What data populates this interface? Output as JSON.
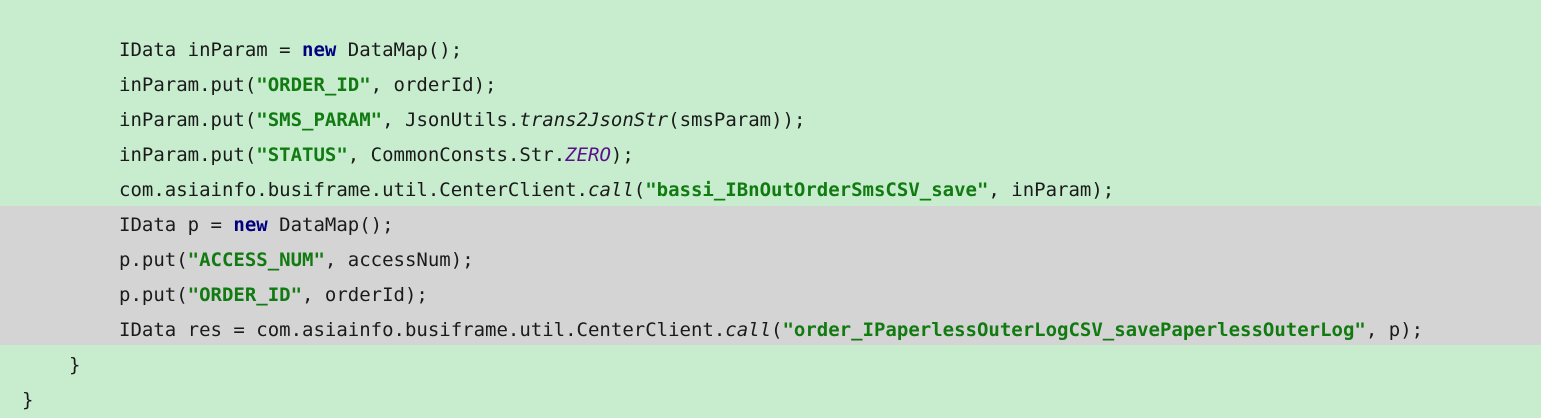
{
  "code": {
    "lines": [
      {
        "indent": 119,
        "tokens": [
          {
            "t": "plain",
            "v": "IData inParam = "
          },
          {
            "t": "kw",
            "v": "new"
          },
          {
            "t": "plain",
            "v": " DataMap();"
          }
        ]
      },
      {
        "indent": 119,
        "tokens": [
          {
            "t": "plain",
            "v": "inParam.put("
          },
          {
            "t": "str",
            "v": "\"ORDER_ID\""
          },
          {
            "t": "plain",
            "v": ", orderId);"
          }
        ]
      },
      {
        "indent": 119,
        "tokens": [
          {
            "t": "plain",
            "v": "inParam.put("
          },
          {
            "t": "str",
            "v": "\"SMS_PARAM\""
          },
          {
            "t": "plain",
            "v": ", JsonUtils."
          },
          {
            "t": "static",
            "v": "trans2JsonStr"
          },
          {
            "t": "plain",
            "v": "(smsParam));"
          }
        ]
      },
      {
        "indent": 119,
        "tokens": [
          {
            "t": "plain",
            "v": "inParam.put("
          },
          {
            "t": "str",
            "v": "\"STATUS\""
          },
          {
            "t": "plain",
            "v": ", CommonConsts.Str."
          },
          {
            "t": "field",
            "v": "ZERO"
          },
          {
            "t": "plain",
            "v": ");"
          }
        ]
      },
      {
        "indent": 119,
        "tokens": [
          {
            "t": "plain",
            "v": "com.asiainfo.busiframe.util.CenterClient."
          },
          {
            "t": "static",
            "v": "call"
          },
          {
            "t": "plain",
            "v": "("
          },
          {
            "t": "str",
            "v": "\"bassi_IBnOutOrderSmsCSV_save\""
          },
          {
            "t": "plain",
            "v": ", inParam);"
          }
        ]
      },
      {
        "indent": 119,
        "tokens": [
          {
            "t": "plain",
            "v": "IData p = "
          },
          {
            "t": "kw",
            "v": "new"
          },
          {
            "t": "plain",
            "v": " DataMap();"
          }
        ]
      },
      {
        "indent": 119,
        "tokens": [
          {
            "t": "plain",
            "v": "p.put("
          },
          {
            "t": "str",
            "v": "\"ACCESS_NUM\""
          },
          {
            "t": "plain",
            "v": ", accessNum);"
          }
        ]
      },
      {
        "indent": 119,
        "tokens": [
          {
            "t": "plain",
            "v": "p.put("
          },
          {
            "t": "str",
            "v": "\"ORDER_ID\""
          },
          {
            "t": "plain",
            "v": ", orderId);"
          }
        ]
      },
      {
        "indent": 119,
        "tokens": [
          {
            "t": "plain",
            "v": "IData res = com.asiainfo.busiframe.util.CenterClient."
          },
          {
            "t": "static",
            "v": "call"
          },
          {
            "t": "plain",
            "v": "("
          },
          {
            "t": "str",
            "v": "\"order_IPaperlessOuterLogCSV_savePaperlessOuterLog\""
          },
          {
            "t": "plain",
            "v": ", p);"
          }
        ]
      },
      {
        "indent": 69,
        "tokens": [
          {
            "t": "plain",
            "v": "}"
          }
        ]
      },
      {
        "indent": 22,
        "tokens": [
          {
            "t": "plain",
            "v": "}"
          }
        ]
      }
    ]
  },
  "colors": {
    "background": "#c7ecce",
    "selection": "#d4d4d4",
    "keyword": "#00007f",
    "string": "#117a11",
    "field": "#5c0f8b"
  }
}
